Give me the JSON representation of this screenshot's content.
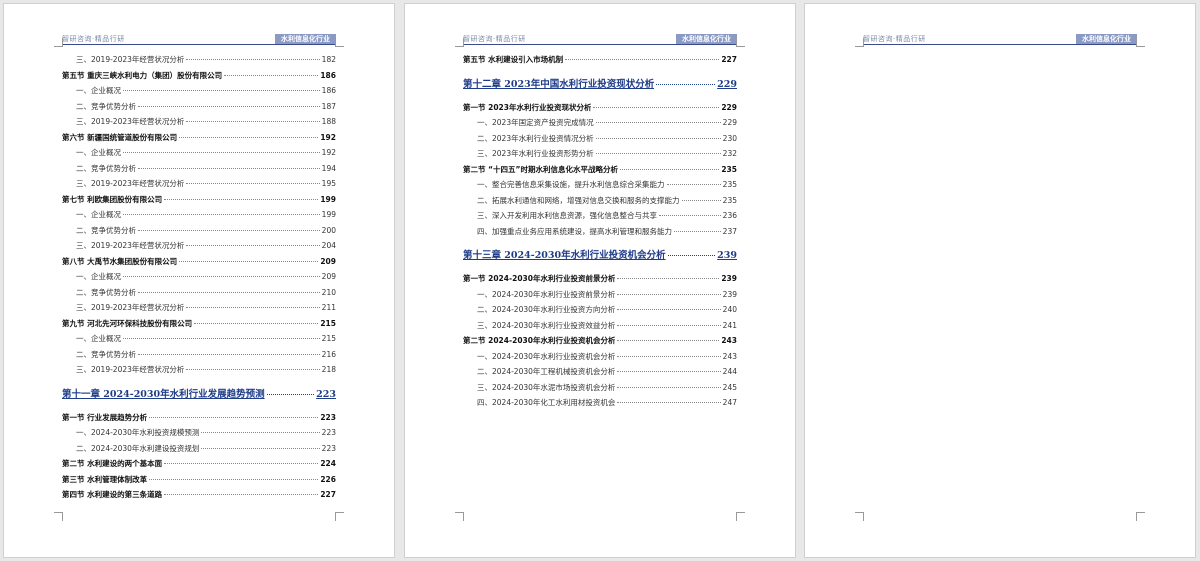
{
  "header": {
    "left_text": "智研咨询·精品行研",
    "right_text": "水利信息化行业"
  },
  "pages": [
    {
      "entries": [
        {
          "level": "sub",
          "title": "三、2019-2023年经营状况分析",
          "page": "182"
        },
        {
          "level": "sec",
          "title": "第五节 重庆三峡水利电力（集团）股份有限公司",
          "page": "186"
        },
        {
          "level": "sub",
          "title": "一、企业概况",
          "page": "186"
        },
        {
          "level": "sub",
          "title": "二、竞争优势分析",
          "page": "187"
        },
        {
          "level": "sub",
          "title": "三、2019-2023年经营状况分析",
          "page": "188"
        },
        {
          "level": "sec",
          "title": "第六节 新疆国统管道股份有限公司",
          "page": "192"
        },
        {
          "level": "sub",
          "title": "一、企业概况",
          "page": "192"
        },
        {
          "level": "sub",
          "title": "二、竞争优势分析",
          "page": "194"
        },
        {
          "level": "sub",
          "title": "三、2019-2023年经营状况分析",
          "page": "195"
        },
        {
          "level": "sec",
          "title": "第七节 利欧集团股份有限公司",
          "page": "199"
        },
        {
          "level": "sub",
          "title": "一、企业概况",
          "page": "199"
        },
        {
          "level": "sub",
          "title": "二、竞争优势分析",
          "page": "200"
        },
        {
          "level": "sub",
          "title": "三、2019-2023年经营状况分析",
          "page": "204"
        },
        {
          "level": "sec",
          "title": "第八节 大禹节水集团股份有限公司",
          "page": "209"
        },
        {
          "level": "sub",
          "title": "一、企业概况",
          "page": "209"
        },
        {
          "level": "sub",
          "title": "二、竞争优势分析",
          "page": "210"
        },
        {
          "level": "sub",
          "title": "三、2019-2023年经营状况分析",
          "page": "211"
        },
        {
          "level": "sec",
          "title": "第九节 河北先河环保科技股份有限公司",
          "page": "215"
        },
        {
          "level": "sub",
          "title": "一、企业概况",
          "page": "215"
        },
        {
          "level": "sub",
          "title": "二、竞争优势分析",
          "page": "216"
        },
        {
          "level": "sub",
          "title": "三、2019-2023年经营状况分析",
          "page": "218"
        },
        {
          "level": "chap",
          "title": "第十一章 2024-2030年水利行业发展趋势预测",
          "page": "223"
        },
        {
          "level": "sec",
          "title": "第一节 行业发展趋势分析",
          "page": "223"
        },
        {
          "level": "sub",
          "title": "一、2024-2030年水利投资规模预测",
          "page": "223"
        },
        {
          "level": "sub",
          "title": "二、2024-2030年水利建设投资规划",
          "page": "223"
        },
        {
          "level": "sec",
          "title": "第二节 水利建设的两个基本面",
          "page": "224"
        },
        {
          "level": "sec",
          "title": "第三节 水利管理体制改革",
          "page": "226"
        },
        {
          "level": "sec",
          "title": "第四节 水利建设的第三条道路",
          "page": "227"
        }
      ]
    },
    {
      "entries": [
        {
          "level": "sec",
          "title": "第五节 水利建设引入市场机制",
          "page": "227"
        },
        {
          "level": "chap",
          "title": "第十二章 2023年中国水利行业投资现状分析",
          "page": "229"
        },
        {
          "level": "sec",
          "title": "第一节 2023年水利行业投资现状分析",
          "page": "229"
        },
        {
          "level": "sub",
          "title": "一、2023年国定资产投资完成情况",
          "page": "229"
        },
        {
          "level": "sub",
          "title": "二、2023年水利行业投资情况分析",
          "page": "230"
        },
        {
          "level": "sub",
          "title": "三、2023年水利行业投资形势分析",
          "page": "232"
        },
        {
          "level": "sec",
          "title": "第二节 “十四五”时期水利信息化水平战略分析",
          "page": "235"
        },
        {
          "level": "sub",
          "title": "一、整合完善信息采集设施，提升水利信息综合采集能力",
          "page": "235"
        },
        {
          "level": "sub",
          "title": "二、拓展水利通信和网络，增强对信息交换和服务的支撑能力",
          "page": "235"
        },
        {
          "level": "sub",
          "title": "三、深入开发利用水利信息资源，强化信息整合与共享",
          "page": "236"
        },
        {
          "level": "sub",
          "title": "四、加强重点业务应用系统建设，提高水利管理和服务能力",
          "page": "237"
        },
        {
          "level": "chap",
          "title": "第十三章 2024-2030年水利行业投资机会分析",
          "page": "239"
        },
        {
          "level": "sec",
          "title": "第一节 2024-2030年水利行业投资前景分析",
          "page": "239"
        },
        {
          "level": "sub",
          "title": "一、2024-2030年水利行业投资前景分析",
          "page": "239"
        },
        {
          "level": "sub",
          "title": "二、2024-2030年水利行业投资方向分析",
          "page": "240"
        },
        {
          "level": "sub",
          "title": "三、2024-2030年水利行业投资效益分析",
          "page": "241"
        },
        {
          "level": "sec",
          "title": "第二节 2024-2030年水利行业投资机会分析",
          "page": "243"
        },
        {
          "level": "sub",
          "title": "一、2024-2030年水利行业投资机会分析",
          "page": "243"
        },
        {
          "level": "sub",
          "title": "二、2024-2030年工程机械投资机会分析",
          "page": "244"
        },
        {
          "level": "sub",
          "title": "三、2024-2030年水泥市场投资机会分析",
          "page": "245"
        },
        {
          "level": "sub",
          "title": "四、2024-2030年化工水利用材投资机会",
          "page": "247"
        }
      ]
    },
    {
      "entries": []
    }
  ]
}
